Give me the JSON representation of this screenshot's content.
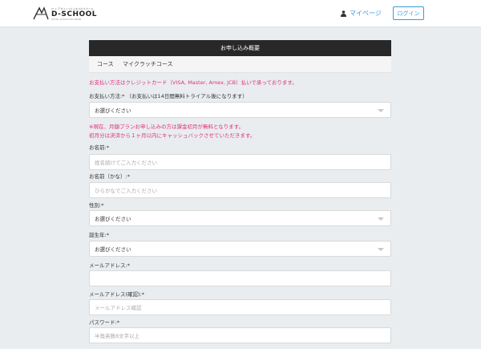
{
  "header": {
    "logo_tagline": "IT × デザイン×ビジネスのスクール",
    "logo_name": "D-SCHOOL",
    "logo_sub": "DIGITAL SCHOOL FOR ONLINE",
    "mypage_label": "マイページ",
    "login_label": "ログイン",
    "accent_color": "#3a9bd9"
  },
  "summary": {
    "title": "お申し込み概要",
    "course_key": "コース",
    "course_value": "マイクラッチコース"
  },
  "form": {
    "payment_note": "お支払い方法はクレジットカード（VISA, Master, Amex, JCB）払いで承っております。",
    "payment_label": "お支払い方法:* （お支払いは14日間無料トライアル後になります）",
    "payment_select": "お選びください",
    "notice_line1": "※現在、月額プランお申し込みの方は課金初月が無料となります。",
    "notice_line2": "初月分は決済から１ヶ月以内にキャッシュバックさせていただきます。",
    "name_label": "お名前:*",
    "name_placeholder": "姓名続けてご入力ください",
    "kana_label": "お名前（かな）:*",
    "kana_placeholder": "ひらがなでご入力ください",
    "gender_label": "性別:*",
    "gender_select": "お選びください",
    "birth_label": "誕生年:*",
    "birth_select": "お選びください",
    "email_label": "メールアドレス:*",
    "email_placeholder": "",
    "email_confirm_label": "メールアドレス(確認):*",
    "email_confirm_placeholder": "メールアドレス確認",
    "password_label": "パスワード:*",
    "password_placeholder": "半角英数8文字以上",
    "notice_color": "#e0317a"
  }
}
